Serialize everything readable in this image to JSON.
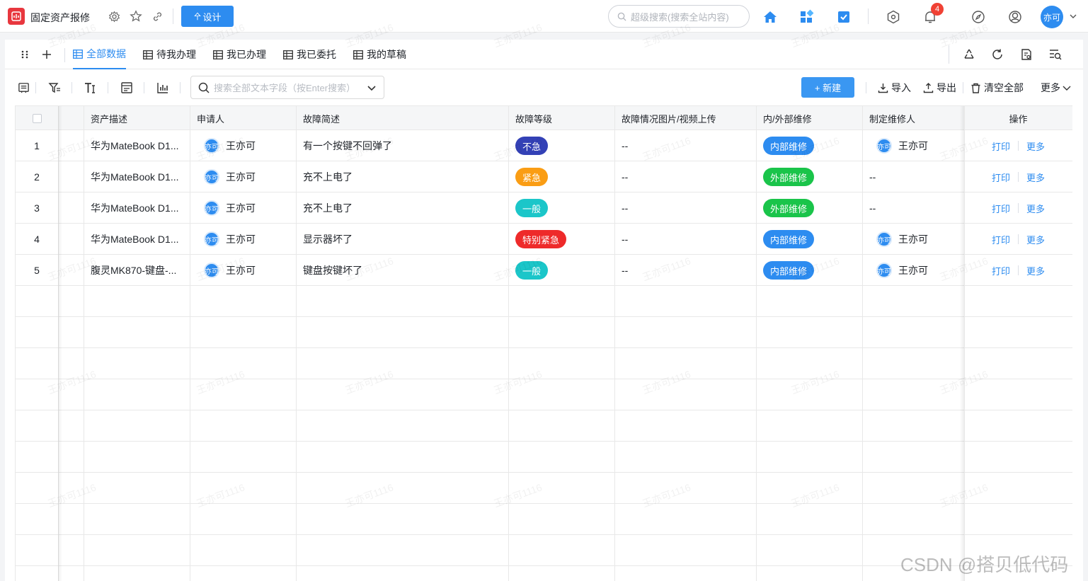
{
  "app": {
    "title": "固定资产报修",
    "design_label": "设计",
    "design_glyph": "㐃",
    "search_placeholder": "超级搜索(搜索全站内容)",
    "notification_count": "4",
    "user_avatar": "亦可"
  },
  "view_tabs": [
    {
      "label": "全部数据",
      "active": true
    },
    {
      "label": "待我办理",
      "active": false
    },
    {
      "label": "我已办理",
      "active": false
    },
    {
      "label": "我已委托",
      "active": false
    },
    {
      "label": "我的草稿",
      "active": false
    }
  ],
  "toolbar": {
    "search_placeholder": "搜索全部文本字段（按Enter搜索）",
    "new_label": "+ 新建",
    "import_label": "导入",
    "export_label": "导出",
    "clear_label": "清空全部",
    "more_label": "更多"
  },
  "table": {
    "columns": [
      "资产描述",
      "申请人",
      "故障简述",
      "故障等级",
      "故障情况图片/视频上传",
      "内/外部维修",
      "制定维修人",
      "操作"
    ],
    "rows": [
      {
        "index": "1",
        "asset": "华为MateBook D1...",
        "applicant": "王亦可",
        "applicant_avatar": "亦可",
        "fault": "有一个按键不回弹了",
        "level": "不急",
        "level_color": "#3341b6",
        "media": "--",
        "repair_type": "内部维修",
        "repair_color": "#2d8cf0",
        "repairer": "王亦可",
        "repairer_avatar": "亦可",
        "print": "打印",
        "more": "更多"
      },
      {
        "index": "2",
        "asset": "华为MateBook D1...",
        "applicant": "王亦可",
        "applicant_avatar": "亦可",
        "fault": "充不上电了",
        "level": "紧急",
        "level_color": "#fa9d14",
        "media": "--",
        "repair_type": "外部维修",
        "repair_color": "#1ac44a",
        "repairer": "--",
        "repairer_avatar": "",
        "print": "打印",
        "more": "更多"
      },
      {
        "index": "3",
        "asset": "华为MateBook D1...",
        "applicant": "王亦可",
        "applicant_avatar": "亦可",
        "fault": "充不上电了",
        "level": "一般",
        "level_color": "#1bc6c9",
        "media": "--",
        "repair_type": "外部维修",
        "repair_color": "#1ac44a",
        "repairer": "--",
        "repairer_avatar": "",
        "print": "打印",
        "more": "更多"
      },
      {
        "index": "4",
        "asset": "华为MateBook D1...",
        "applicant": "王亦可",
        "applicant_avatar": "亦可",
        "fault": "显示器坏了",
        "level": "特别紧急",
        "level_color": "#ee2a2a",
        "media": "--",
        "repair_type": "内部维修",
        "repair_color": "#2d8cf0",
        "repairer": "王亦可",
        "repairer_avatar": "亦可",
        "print": "打印",
        "more": "更多"
      },
      {
        "index": "5",
        "asset": "腹灵MK870-键盘-...",
        "applicant": "王亦可",
        "applicant_avatar": "亦可",
        "fault": "键盘按键坏了",
        "level": "一般",
        "level_color": "#1bc6c9",
        "media": "--",
        "repair_type": "内部维修",
        "repair_color": "#2d8cf0",
        "repairer": "王亦可",
        "repairer_avatar": "亦可",
        "print": "打印",
        "more": "更多"
      }
    ]
  },
  "watermark": "王亦可1116",
  "footer_mark": "CSDN @搭贝低代码",
  "colors": {
    "accent": "#2d8cf0",
    "danger": "#f04134"
  }
}
